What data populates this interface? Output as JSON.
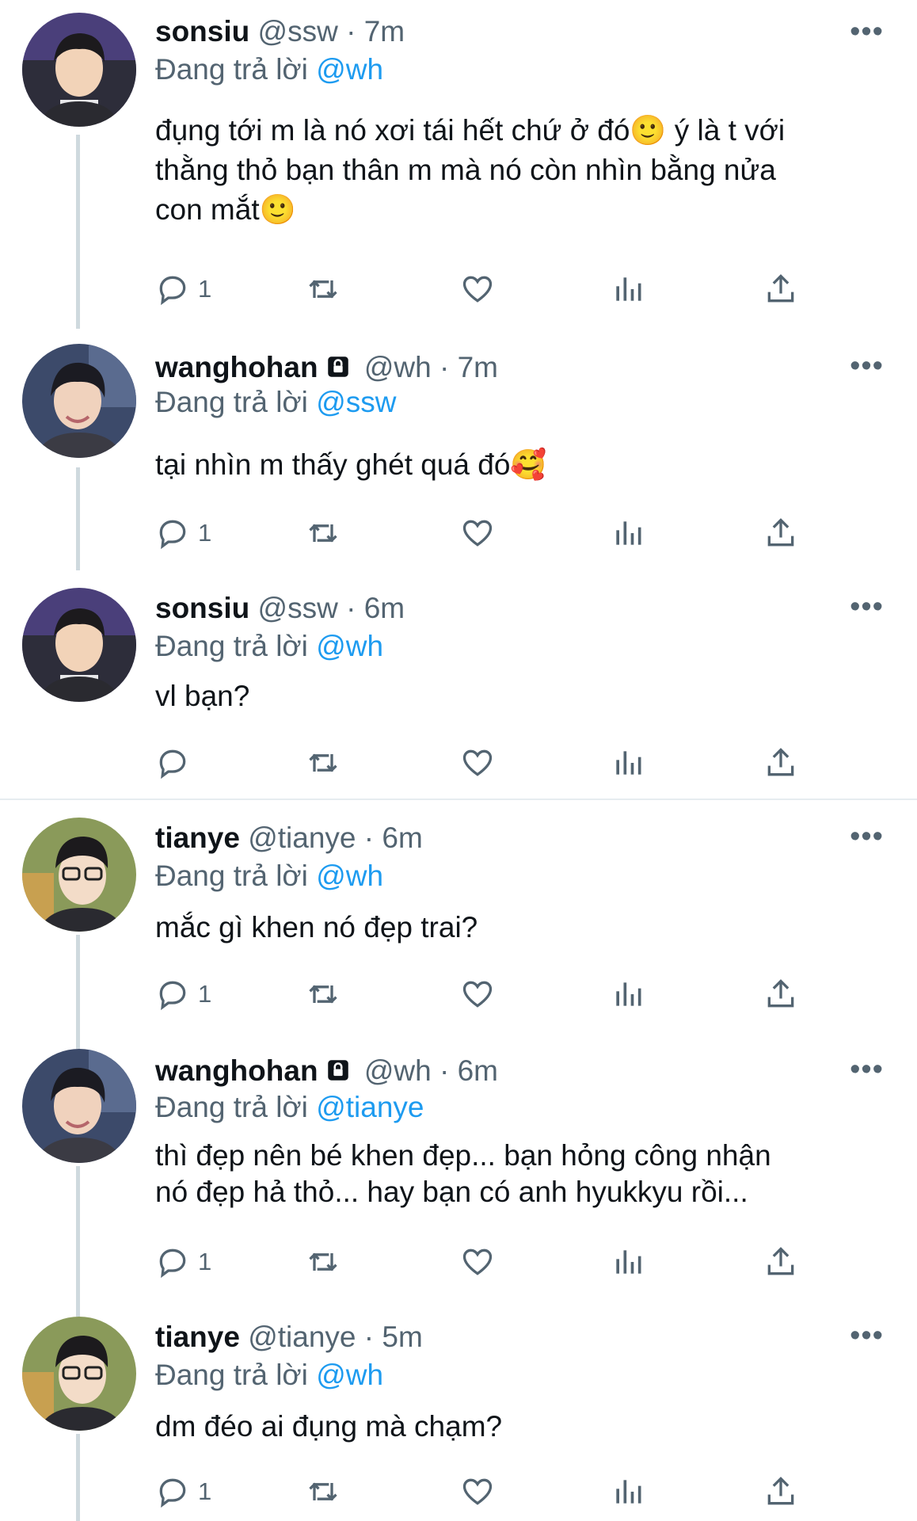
{
  "tweets": [
    {
      "name": "sonsiu",
      "handle": "@ssw",
      "time": "7m",
      "locked": false,
      "reply_label": "Đang trả lời",
      "reply_to": "@wh",
      "lines": [
        "đụng tới m là nó xơi tái hết chứ ở đó🙂  ý là t với",
        "thằng thỏ bạn thân m mà nó còn nhìn bằng nửa",
        "con mắt🙂"
      ],
      "reply_count": "1",
      "avatar": "avatar-sonsiu"
    },
    {
      "name": "wanghohan",
      "handle": "@wh",
      "time": "7m",
      "locked": true,
      "reply_label": "Đang trả lời",
      "reply_to": "@ssw",
      "lines": [
        "tại nhìn m thấy ghét quá đó🥰"
      ],
      "reply_count": "1",
      "avatar": "avatar-wanghohan"
    },
    {
      "name": "sonsiu",
      "handle": "@ssw",
      "time": "6m",
      "locked": false,
      "reply_label": "Đang trả lời",
      "reply_to": "@wh",
      "lines": [
        "vl bạn?"
      ],
      "reply_count": "",
      "avatar": "avatar-sonsiu"
    },
    {
      "name": "tianye",
      "handle": "@tianye",
      "time": "6m",
      "locked": false,
      "reply_label": "Đang trả lời",
      "reply_to": "@wh",
      "lines": [
        "mắc gì khen nó đẹp trai?"
      ],
      "reply_count": "1",
      "avatar": "avatar-tianye"
    },
    {
      "name": "wanghohan",
      "handle": "@wh",
      "time": "6m",
      "locked": true,
      "reply_label": "Đang trả lời",
      "reply_to": "@tianye",
      "lines": [
        "thì đẹp nên bé khen đẹp... bạn hỏng công nhận",
        "nó đẹp hả thỏ... hay bạn có anh hyukkyu rồi..."
      ],
      "reply_count": "1",
      "avatar": "avatar-wanghohan"
    },
    {
      "name": "tianye",
      "handle": "@tianye",
      "time": "5m",
      "locked": false,
      "reply_label": "Đang trả lời",
      "reply_to": "@wh",
      "lines": [
        "dm đéo ai đụng mà chạm?"
      ],
      "reply_count": "1",
      "avatar": "avatar-tianye"
    }
  ],
  "separator": "·",
  "more_icon": "more-icon",
  "colors": {
    "mention": "#1d9bf0",
    "secondary": "#536471",
    "text": "#0f1419",
    "thread_line": "#cfd9de"
  }
}
